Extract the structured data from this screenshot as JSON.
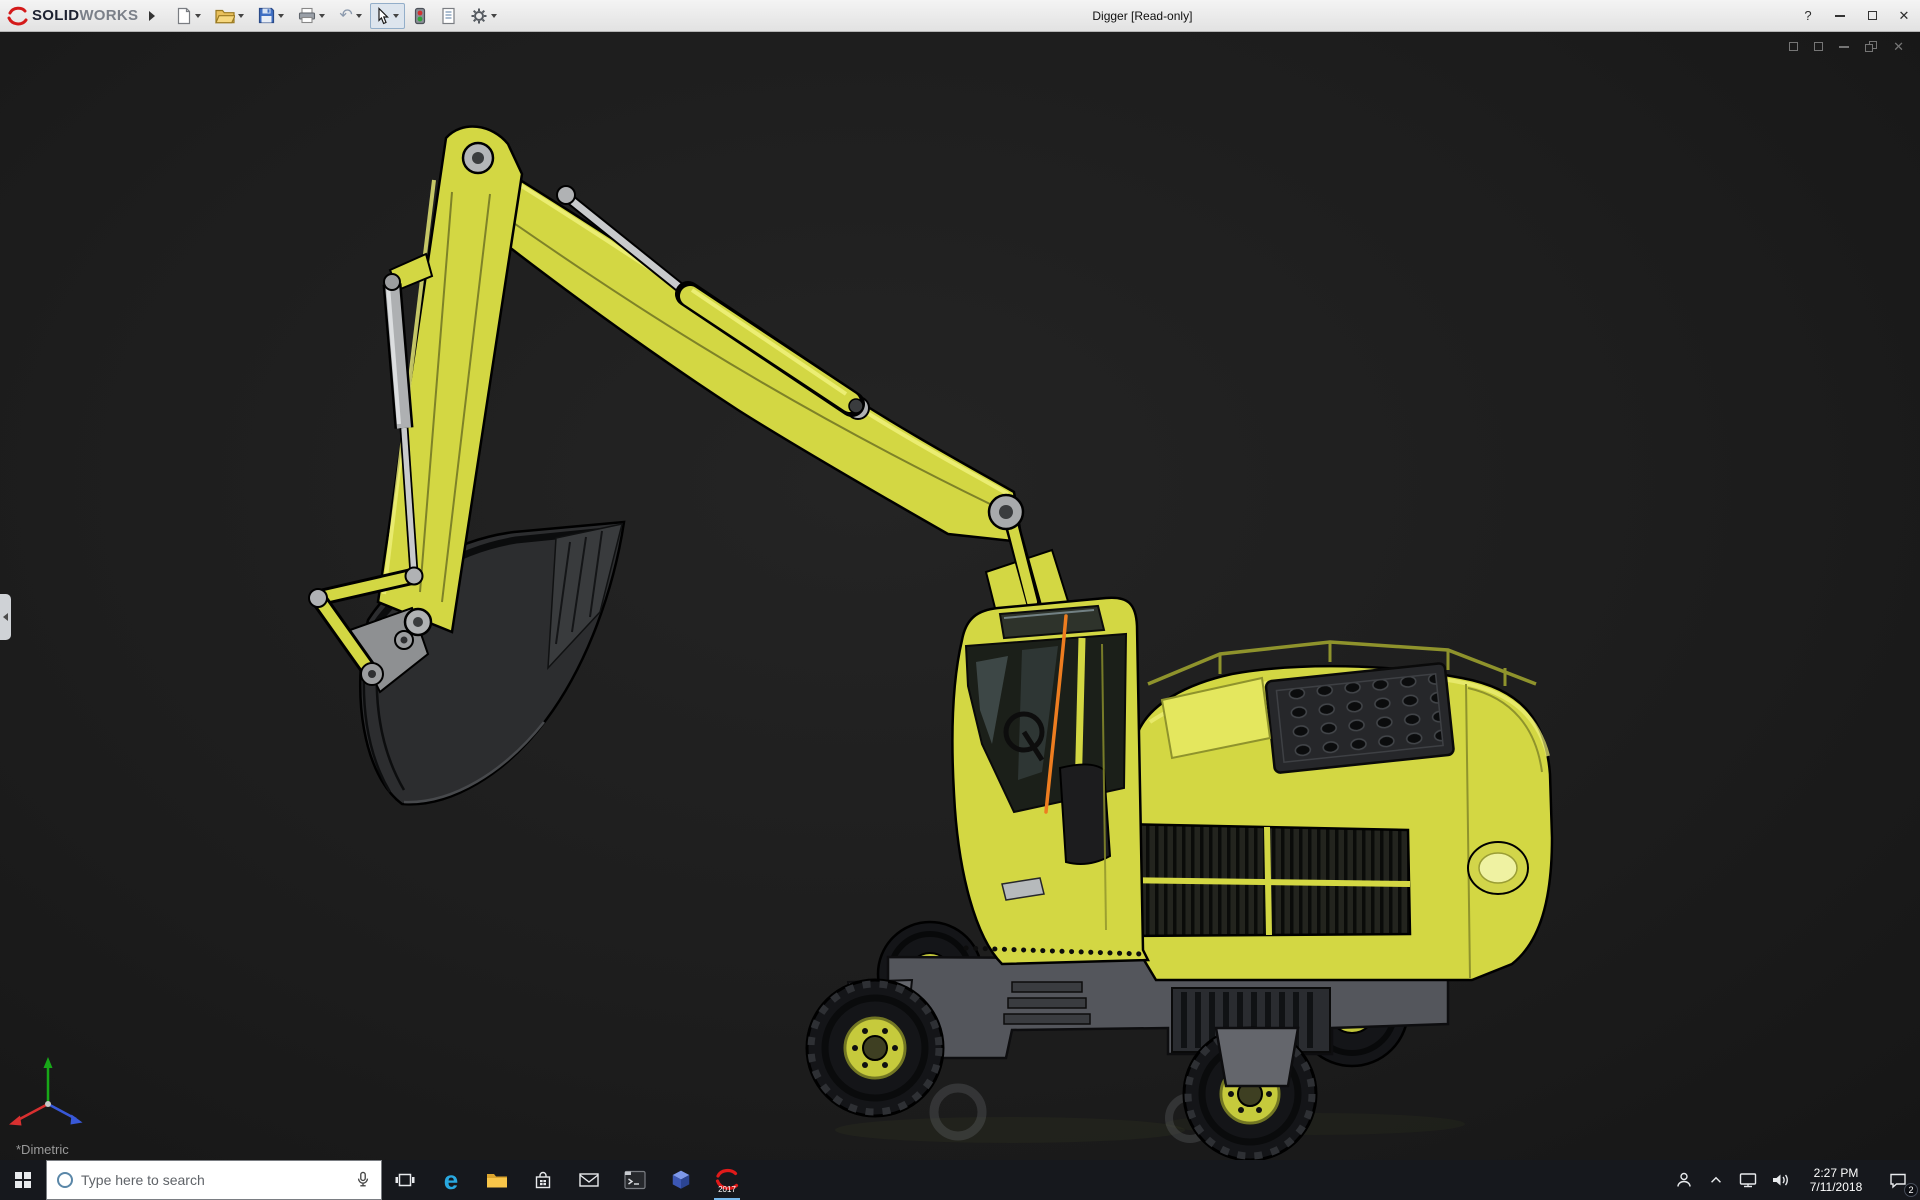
{
  "colors": {
    "excavator_yellow": "#d3d743",
    "excavator_yellow_dark": "#8f932c",
    "excavator_highlight": "#eff17a",
    "selection_orange": "#ee7d20",
    "viewport_background": "#1e1e1e",
    "titlebar_background": "#e9e9e9",
    "taskbar_background": "#16181d",
    "tire_black": "#141518",
    "metal_silver": "#b4b6b8",
    "chassis_gray": "#54565c"
  },
  "titlebar": {
    "brand_solid": "SOLID",
    "brand_works": "WORKS",
    "document_title": "Digger [Read-only]",
    "help": "?"
  },
  "icons": {
    "undo": "↶",
    "close": "✕",
    "doc_close": "✕",
    "edge": "e"
  },
  "viewport": {
    "view_orientation": "*Dimetric"
  },
  "taskbar": {
    "search_placeholder": "Type here to search",
    "sw_year": "2017",
    "time": "2:27 PM",
    "date": "7/11/2018",
    "notification_badge": "2"
  }
}
